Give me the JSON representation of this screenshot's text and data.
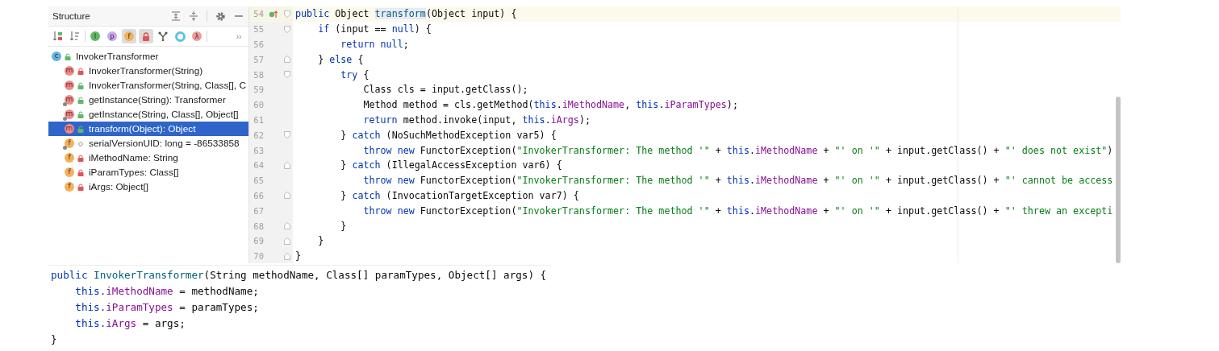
{
  "structure": {
    "title": "Structure",
    "toolbar": [
      {
        "kind": "sort-type",
        "pressed": false
      },
      {
        "kind": "sort-alpha",
        "pressed": false
      },
      {
        "kind": "badge",
        "glyph": "I",
        "color": "#5fb865",
        "pressed": false
      },
      {
        "kind": "badge",
        "glyph": "p",
        "color": "#c9a7f0",
        "pressed": false
      },
      {
        "kind": "badge",
        "glyph": "f",
        "color": "#f3b25a",
        "pressed": true
      },
      {
        "kind": "lock",
        "pressed": true
      },
      {
        "kind": "fork",
        "pressed": false
      },
      {
        "kind": "ring",
        "pressed": false
      },
      {
        "kind": "badge",
        "glyph": "λ",
        "color": "#f29a9a",
        "pressed": false
      },
      {
        "kind": "more",
        "glyph": "››",
        "pressed": false
      }
    ],
    "tree": [
      {
        "label": "InvokerTransformer",
        "icon": "c",
        "kind": "class",
        "locked": false,
        "package_private": false,
        "static": false,
        "selected": false,
        "children": [
          {
            "label": "InvokerTransformer(String)",
            "icon": "m",
            "kind": "method",
            "locked": true,
            "package_private": false,
            "static": false,
            "selected": false
          },
          {
            "label": "InvokerTransformer(String, Class[], C",
            "icon": "m",
            "kind": "method",
            "locked": false,
            "package_private": false,
            "static": false,
            "selected": false
          },
          {
            "label": "getInstance(String): Transformer",
            "icon": "m",
            "kind": "method",
            "locked": false,
            "package_private": false,
            "static": true,
            "selected": false
          },
          {
            "label": "getInstance(String, Class[], Object[]",
            "icon": "m",
            "kind": "method",
            "locked": false,
            "package_private": false,
            "static": true,
            "selected": false
          },
          {
            "label": "transform(Object): Object",
            "icon": "m",
            "kind": "method",
            "locked": false,
            "package_private": false,
            "static": false,
            "selected": true
          },
          {
            "label": "serialVersionUID: long = -86533858",
            "icon": "f",
            "kind": "field",
            "locked": false,
            "package_private": true,
            "static": true,
            "selected": false
          },
          {
            "label": "iMethodName: String",
            "icon": "f",
            "kind": "field",
            "locked": true,
            "package_private": false,
            "static": false,
            "selected": false
          },
          {
            "label": "iParamTypes: Class[]",
            "icon": "f",
            "kind": "field",
            "locked": true,
            "package_private": false,
            "static": false,
            "selected": false
          },
          {
            "label": "iArgs: Object[]",
            "icon": "f",
            "kind": "field",
            "locked": true,
            "package_private": false,
            "static": false,
            "selected": false
          }
        ]
      }
    ]
  },
  "editor": {
    "lines": [
      {
        "number": "54",
        "current": true,
        "marker": true,
        "fold_start": true,
        "fold_end": false,
        "tokens": [
          {
            "kind": "kw",
            "text": "public "
          },
          {
            "kind": "plain",
            "text": "Object "
          },
          {
            "kind": "decl-hl",
            "text": "transform"
          },
          {
            "kind": "plain",
            "text": "(Object input) {"
          }
        ]
      },
      {
        "number": "55",
        "current": false,
        "marker": false,
        "fold_start": true,
        "fold_end": false,
        "tokens": [
          {
            "kind": "kw",
            "text": "    if"
          },
          {
            "kind": "plain",
            "text": " (input == "
          },
          {
            "kind": "kw",
            "text": "null"
          },
          {
            "kind": "plain",
            "text": ") {"
          }
        ]
      },
      {
        "number": "56",
        "current": false,
        "marker": false,
        "fold_start": false,
        "fold_end": false,
        "tokens": [
          {
            "kind": "kw",
            "text": "        return null"
          },
          {
            "kind": "plain",
            "text": ";"
          }
        ]
      },
      {
        "number": "57",
        "current": false,
        "marker": false,
        "fold_start": false,
        "fold_end": true,
        "tokens": [
          {
            "kind": "plain",
            "text": "    } "
          },
          {
            "kind": "kw",
            "text": "else"
          },
          {
            "kind": "plain",
            "text": " {"
          }
        ]
      },
      {
        "number": "58",
        "current": false,
        "marker": false,
        "fold_start": true,
        "fold_end": false,
        "tokens": [
          {
            "kind": "kw",
            "text": "        try"
          },
          {
            "kind": "plain",
            "text": " {"
          }
        ]
      },
      {
        "number": "59",
        "current": false,
        "marker": false,
        "fold_start": false,
        "fold_end": false,
        "tokens": [
          {
            "kind": "plain",
            "text": "            Class cls = input.getClass();"
          }
        ]
      },
      {
        "number": "60",
        "current": false,
        "marker": false,
        "fold_start": false,
        "fold_end": false,
        "tokens": [
          {
            "kind": "plain",
            "text": "            Method method = cls.getMethod("
          },
          {
            "kind": "kw",
            "text": "this"
          },
          {
            "kind": "plain",
            "text": "."
          },
          {
            "kind": "field",
            "text": "iMethodName"
          },
          {
            "kind": "plain",
            "text": ", "
          },
          {
            "kind": "kw",
            "text": "this"
          },
          {
            "kind": "plain",
            "text": "."
          },
          {
            "kind": "field",
            "text": "iParamTypes"
          },
          {
            "kind": "plain",
            "text": ");"
          }
        ]
      },
      {
        "number": "61",
        "current": false,
        "marker": false,
        "fold_start": false,
        "fold_end": false,
        "tokens": [
          {
            "kind": "kw",
            "text": "            return"
          },
          {
            "kind": "plain",
            "text": " method.invoke(input, "
          },
          {
            "kind": "kw",
            "text": "this"
          },
          {
            "kind": "plain",
            "text": "."
          },
          {
            "kind": "field",
            "text": "iArgs"
          },
          {
            "kind": "plain",
            "text": ");"
          }
        ]
      },
      {
        "number": "62",
        "current": false,
        "marker": false,
        "fold_start": true,
        "fold_end": false,
        "tokens": [
          {
            "kind": "plain",
            "text": "        } "
          },
          {
            "kind": "kw",
            "text": "catch"
          },
          {
            "kind": "plain",
            "text": " (NoSuchMethodException var5) {"
          }
        ]
      },
      {
        "number": "63",
        "current": false,
        "marker": false,
        "fold_start": false,
        "fold_end": false,
        "tokens": [
          {
            "kind": "kw",
            "text": "            throw new"
          },
          {
            "kind": "plain",
            "text": " FunctorException("
          },
          {
            "kind": "str",
            "text": "\"InvokerTransformer: The method '\""
          },
          {
            "kind": "plain",
            "text": " + "
          },
          {
            "kind": "kw",
            "text": "this"
          },
          {
            "kind": "plain",
            "text": "."
          },
          {
            "kind": "field",
            "text": "iMethodName"
          },
          {
            "kind": "plain",
            "text": " + "
          },
          {
            "kind": "str",
            "text": "\"' on '\""
          },
          {
            "kind": "plain",
            "text": " + input.getClass() + "
          },
          {
            "kind": "str",
            "text": "\"' does not exist\""
          },
          {
            "kind": "plain",
            "text": ")"
          }
        ]
      },
      {
        "number": "64",
        "current": false,
        "marker": false,
        "fold_start": false,
        "fold_end": true,
        "tokens": [
          {
            "kind": "plain",
            "text": "        } "
          },
          {
            "kind": "kw",
            "text": "catch"
          },
          {
            "kind": "plain",
            "text": " (IllegalAccessException var6) {"
          }
        ]
      },
      {
        "number": "65",
        "current": false,
        "marker": false,
        "fold_start": false,
        "fold_end": false,
        "tokens": [
          {
            "kind": "kw",
            "text": "            throw new"
          },
          {
            "kind": "plain",
            "text": " FunctorException("
          },
          {
            "kind": "str",
            "text": "\"InvokerTransformer: The method '\""
          },
          {
            "kind": "plain",
            "text": " + "
          },
          {
            "kind": "kw",
            "text": "this"
          },
          {
            "kind": "plain",
            "text": "."
          },
          {
            "kind": "field",
            "text": "iMethodName"
          },
          {
            "kind": "plain",
            "text": " + "
          },
          {
            "kind": "str",
            "text": "\"' on '\""
          },
          {
            "kind": "plain",
            "text": " + input.getClass() + "
          },
          {
            "kind": "str",
            "text": "\"' cannot be access"
          }
        ]
      },
      {
        "number": "66",
        "current": false,
        "marker": false,
        "fold_start": false,
        "fold_end": true,
        "tokens": [
          {
            "kind": "plain",
            "text": "        } "
          },
          {
            "kind": "kw",
            "text": "catch"
          },
          {
            "kind": "plain",
            "text": " (InvocationTargetException var7) {"
          }
        ]
      },
      {
        "number": "67",
        "current": false,
        "marker": false,
        "fold_start": false,
        "fold_end": false,
        "tokens": [
          {
            "kind": "kw",
            "text": "            throw new"
          },
          {
            "kind": "plain",
            "text": " FunctorException("
          },
          {
            "kind": "str",
            "text": "\"InvokerTransformer: The method '\""
          },
          {
            "kind": "plain",
            "text": " + "
          },
          {
            "kind": "kw",
            "text": "this"
          },
          {
            "kind": "plain",
            "text": "."
          },
          {
            "kind": "field",
            "text": "iMethodName"
          },
          {
            "kind": "plain",
            "text": " + "
          },
          {
            "kind": "str",
            "text": "\"' on '\""
          },
          {
            "kind": "plain",
            "text": " + input.getClass() + "
          },
          {
            "kind": "str",
            "text": "\"' threw an excepti"
          }
        ]
      },
      {
        "number": "68",
        "current": false,
        "marker": false,
        "fold_start": false,
        "fold_end": true,
        "tokens": [
          {
            "kind": "plain",
            "text": "        }"
          }
        ]
      },
      {
        "number": "69",
        "current": false,
        "marker": false,
        "fold_start": false,
        "fold_end": true,
        "tokens": [
          {
            "kind": "plain",
            "text": "    }"
          }
        ]
      },
      {
        "number": "70",
        "current": false,
        "marker": false,
        "fold_start": false,
        "fold_end": true,
        "tokens": [
          {
            "kind": "plain",
            "text": "}"
          }
        ]
      }
    ]
  },
  "snippet": {
    "lines": [
      {
        "tokens": [
          {
            "kind": "kw",
            "text": "public "
          },
          {
            "kind": "decl",
            "text": "InvokerTransformer"
          },
          {
            "kind": "plain",
            "text": "(String methodName, Class[] paramTypes, Object[] args) {"
          }
        ]
      },
      {
        "tokens": [
          {
            "kind": "kw",
            "text": "    this."
          },
          {
            "kind": "field",
            "text": "iMethodName"
          },
          {
            "kind": "plain",
            "text": " = methodName;"
          }
        ]
      },
      {
        "tokens": [
          {
            "kind": "kw",
            "text": "    this."
          },
          {
            "kind": "field",
            "text": "iParamTypes"
          },
          {
            "kind": "plain",
            "text": " = paramTypes;"
          }
        ]
      },
      {
        "tokens": [
          {
            "kind": "kw",
            "text": "    this."
          },
          {
            "kind": "field",
            "text": "iArgs"
          },
          {
            "kind": "plain",
            "text": " = args;"
          }
        ]
      },
      {
        "tokens": [
          {
            "kind": "plain",
            "text": "}"
          }
        ]
      }
    ]
  }
}
